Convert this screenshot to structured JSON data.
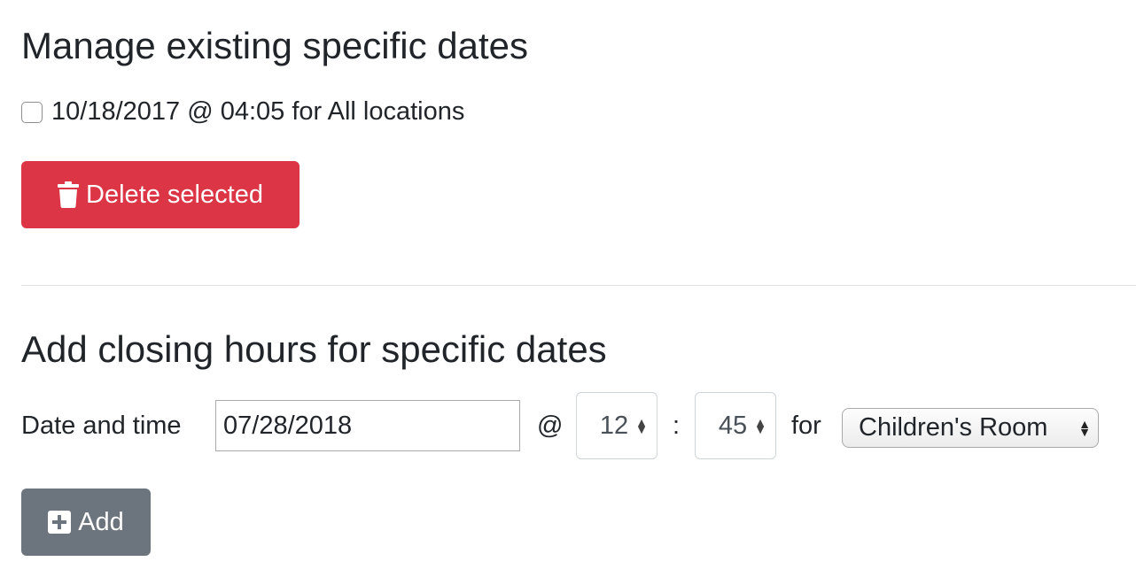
{
  "manage": {
    "heading": "Manage existing specific dates",
    "entries": [
      {
        "label": "10/18/2017 @ 04:05 for All locations",
        "checked": false
      }
    ],
    "delete_label": "Delete selected"
  },
  "add": {
    "heading": "Add closing hours for specific dates",
    "date_label": "Date and time",
    "date_value": "07/28/2018",
    "at_label": "@",
    "hour_value": "12",
    "colon_label": ":",
    "minute_value": "45",
    "for_label": "for",
    "location_value": "Children's Room",
    "add_label": "Add"
  },
  "colors": {
    "danger": "#dc3545",
    "secondary": "#6c757d"
  },
  "icons": {
    "delete": "trash-icon",
    "add": "plus-square-icon",
    "stepper": "up-down-arrows-icon"
  }
}
